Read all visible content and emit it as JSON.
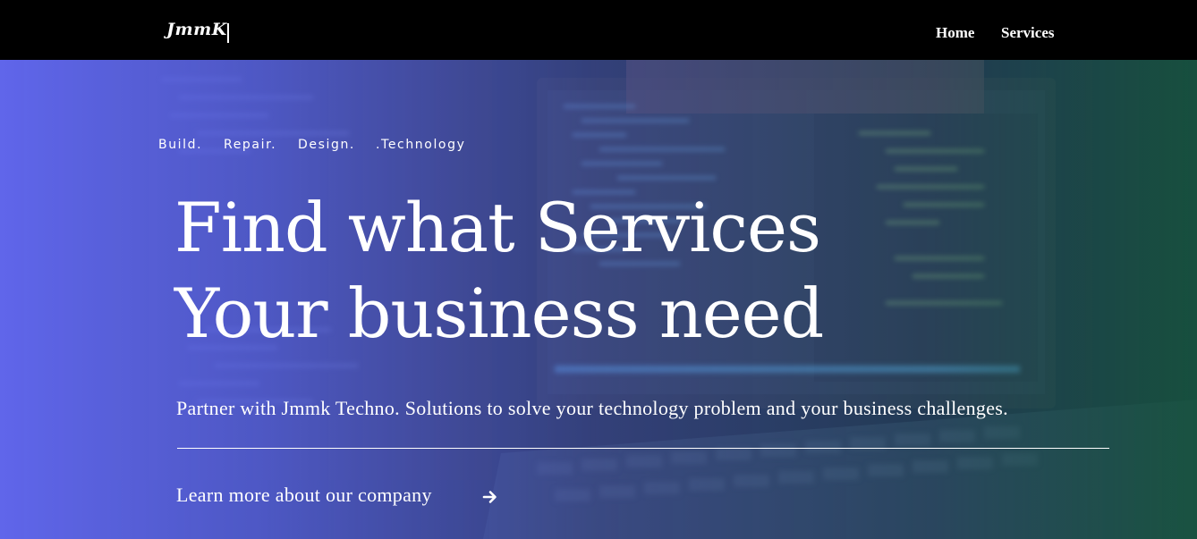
{
  "navbar": {
    "brand": "JmmK",
    "links": [
      "Home",
      "Services"
    ]
  },
  "hero": {
    "tagline": [
      "Build.",
      "Repair.",
      "Design.",
      ".Technology"
    ],
    "headline": [
      "Find what Services",
      "Your business need"
    ],
    "subtext": "Partner with Jmmk Techno. Solutions to solve your technology problem and your business challenges.",
    "cta": "Learn more about our company",
    "cta_icon": "arrow-right-icon"
  },
  "colors": {
    "navbar_bg": "#000000",
    "gradient_left": "#6268f0",
    "gradient_right": "#16563e",
    "text": "#ffffff"
  }
}
